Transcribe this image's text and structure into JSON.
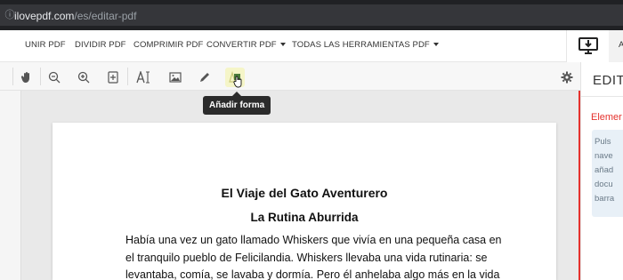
{
  "browser": {
    "url_domain": "ilovepdf.com",
    "url_path": "/es/editar-pdf"
  },
  "nav": {
    "items": [
      {
        "label": "UNIR PDF",
        "dropdown": false
      },
      {
        "label": "DIVIDIR PDF",
        "dropdown": false
      },
      {
        "label": "COMPRIMIR PDF",
        "dropdown": false
      },
      {
        "label": "CONVERTIR PDF",
        "dropdown": true
      },
      {
        "label": "TODAS LAS HERRAMIENTAS PDF",
        "dropdown": true
      }
    ],
    "right_cut_label": "A"
  },
  "toolbar": {
    "tools": [
      "hand-icon",
      "zoom-out-icon",
      "zoom-in-icon",
      "add-page-icon",
      "text-icon",
      "image-icon",
      "pencil-icon",
      "shape-icon"
    ],
    "active_tool": "shape-icon",
    "tooltip": "Añadir forma"
  },
  "document": {
    "title": "El Viaje del Gato Aventurero",
    "subtitle": "La Rutina Aburrida",
    "lines": [
      "Había una vez un gato llamado Whiskers que vivía en una pequeña casa en",
      "el tranquilo pueblo de Felicilandia. Whiskers llevaba una vida rutinaria: se",
      "levantaba, comía, se lavaba y dormía. Pero él anhelaba algo más en la vida"
    ]
  },
  "panel": {
    "title": "EDIT",
    "subtitle": "Elemer",
    "info_lines": [
      "Puls",
      "nave",
      "añad",
      "docu",
      "barra"
    ]
  },
  "colors": {
    "accent": "#e5322d",
    "urlbar": "#202124",
    "tooltip": "#2b2b2b",
    "active_tool_bg": "#f5f5c8"
  }
}
